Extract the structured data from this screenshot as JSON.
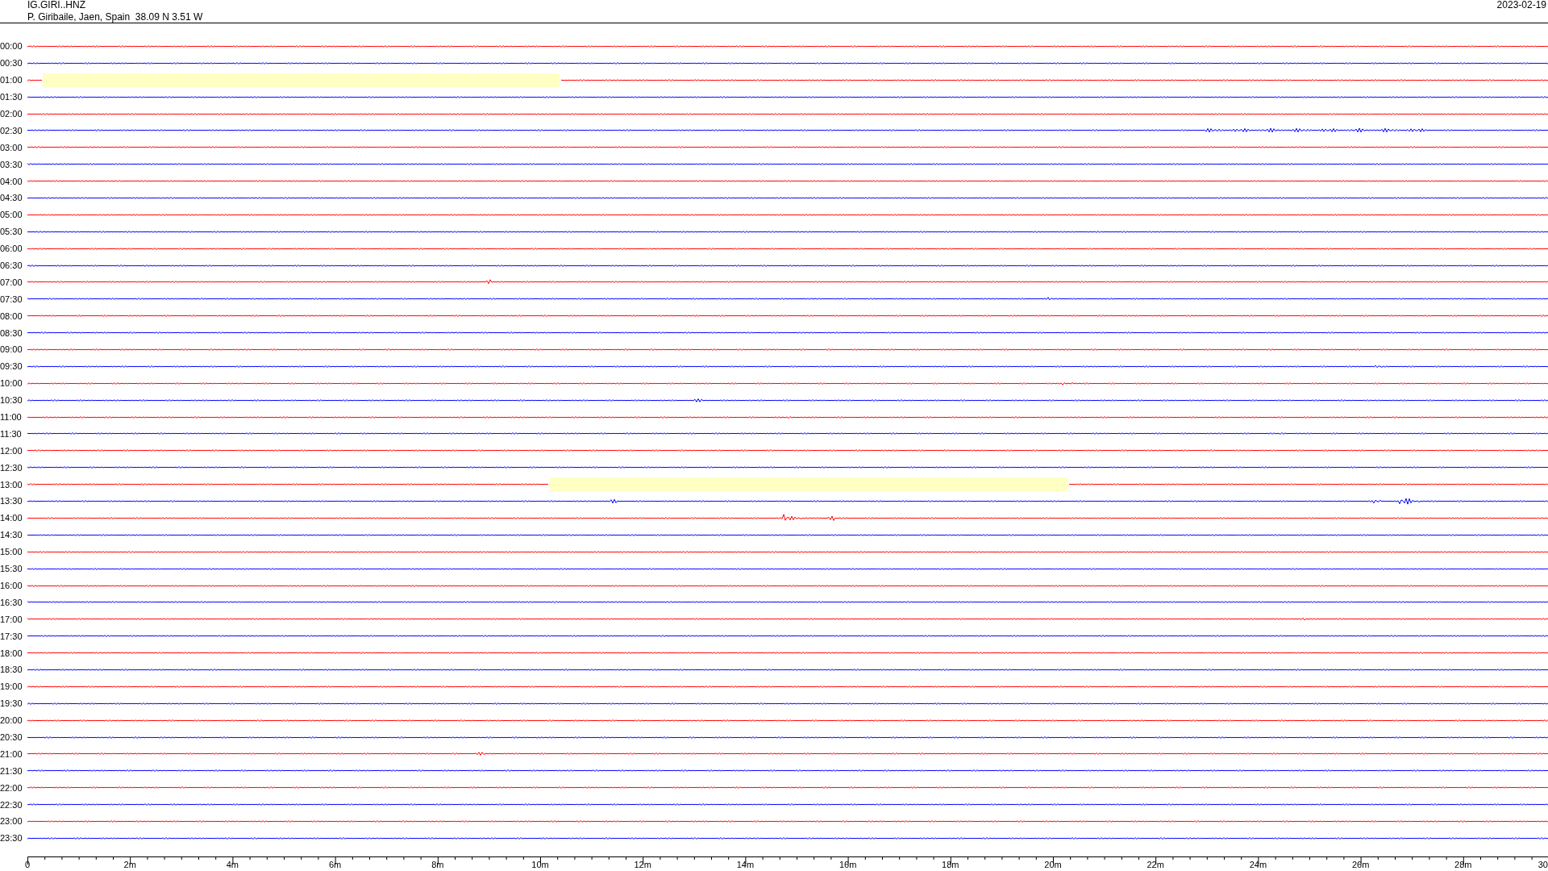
{
  "header": {
    "station": "IG.GIRI..HNZ",
    "location": "P. Giribaile, Jaen, Spain  38.09 N 3.51 W",
    "date": "2023-02-19"
  },
  "rows": [
    {
      "time": "00:00",
      "color": "#ff0000",
      "gap": false
    },
    {
      "time": "00:30",
      "color": "#0000ff",
      "gap": false
    },
    {
      "time": "01:00",
      "color": "#ff0000",
      "gap": true
    },
    {
      "time": "01:30",
      "color": "#0000ff",
      "gap": false
    },
    {
      "time": "02:00",
      "color": "#ff0000",
      "gap": false
    },
    {
      "time": "02:30",
      "color": "#0000ff",
      "gap": false
    },
    {
      "time": "03:00",
      "color": "#ff0000",
      "gap": false
    },
    {
      "time": "03:30",
      "color": "#0000ff",
      "gap": false
    },
    {
      "time": "04:00",
      "color": "#ff0000",
      "gap": false
    },
    {
      "time": "04:30",
      "color": "#0000ff",
      "gap": false
    },
    {
      "time": "05:00",
      "color": "#ff0000",
      "gap": false
    },
    {
      "time": "05:30",
      "color": "#0000ff",
      "gap": false
    },
    {
      "time": "06:00",
      "color": "#ff0000",
      "gap": false
    },
    {
      "time": "06:30",
      "color": "#0000ff",
      "gap": false
    },
    {
      "time": "07:00",
      "color": "#ff0000",
      "gap": false
    },
    {
      "time": "07:30",
      "color": "#0000ff",
      "gap": false
    },
    {
      "time": "08:00",
      "color": "#ff0000",
      "gap": false
    },
    {
      "time": "08:30",
      "color": "#0000ff",
      "gap": false
    },
    {
      "time": "09:00",
      "color": "#ff0000",
      "gap": false
    },
    {
      "time": "09:30",
      "color": "#0000ff",
      "gap": false
    },
    {
      "time": "10:00",
      "color": "#ff0000",
      "gap": false
    },
    {
      "time": "10:30",
      "color": "#0000ff",
      "gap": false
    },
    {
      "time": "11:00",
      "color": "#ff0000",
      "gap": false
    },
    {
      "time": "11:30",
      "color": "#0000ff",
      "gap": false
    },
    {
      "time": "12:00",
      "color": "#ff0000",
      "gap": false
    },
    {
      "time": "12:30",
      "color": "#0000ff",
      "gap": false
    },
    {
      "time": "13:00",
      "color": "#ff0000",
      "gap": true
    },
    {
      "time": "13:30",
      "color": "#0000ff",
      "gap": false
    },
    {
      "time": "14:00",
      "color": "#ff0000",
      "gap": false
    },
    {
      "time": "14:30",
      "color": "#0000ff",
      "gap": false
    },
    {
      "time": "15:00",
      "color": "#ff0000",
      "gap": false
    },
    {
      "time": "15:30",
      "color": "#0000ff",
      "gap": false
    },
    {
      "time": "16:00",
      "color": "#ff0000",
      "gap": false
    },
    {
      "time": "16:30",
      "color": "#0000ff",
      "gap": false
    },
    {
      "time": "17:00",
      "color": "#ff0000",
      "gap": false
    },
    {
      "time": "17:30",
      "color": "#0000ff",
      "gap": false
    },
    {
      "time": "18:00",
      "color": "#ff0000",
      "gap": false
    },
    {
      "time": "18:30",
      "color": "#0000ff",
      "gap": false
    },
    {
      "time": "19:00",
      "color": "#ff0000",
      "gap": false
    },
    {
      "time": "19:30",
      "color": "#0000ff",
      "gap": false
    },
    {
      "time": "20:00",
      "color": "#ff0000",
      "gap": false
    },
    {
      "time": "20:30",
      "color": "#0000ff",
      "gap": false
    },
    {
      "time": "21:00",
      "color": "#ff0000",
      "gap": false
    },
    {
      "time": "21:30",
      "color": "#0000ff",
      "gap": false
    },
    {
      "time": "22:00",
      "color": "#ff0000",
      "gap": false
    },
    {
      "time": "22:30",
      "color": "#0000ff",
      "gap": false
    },
    {
      "time": "23:00",
      "color": "#ff0000",
      "gap": false
    },
    {
      "time": "23:30",
      "color": "#0000ff",
      "gap": false
    }
  ],
  "time_axis": {
    "labels": [
      "0",
      "2m",
      "4m",
      "6m",
      "8m",
      "10m",
      "12m",
      "14m",
      "16m",
      "18m",
      "20m",
      "22m",
      "24m",
      "26m",
      "28m",
      "30"
    ]
  }
}
